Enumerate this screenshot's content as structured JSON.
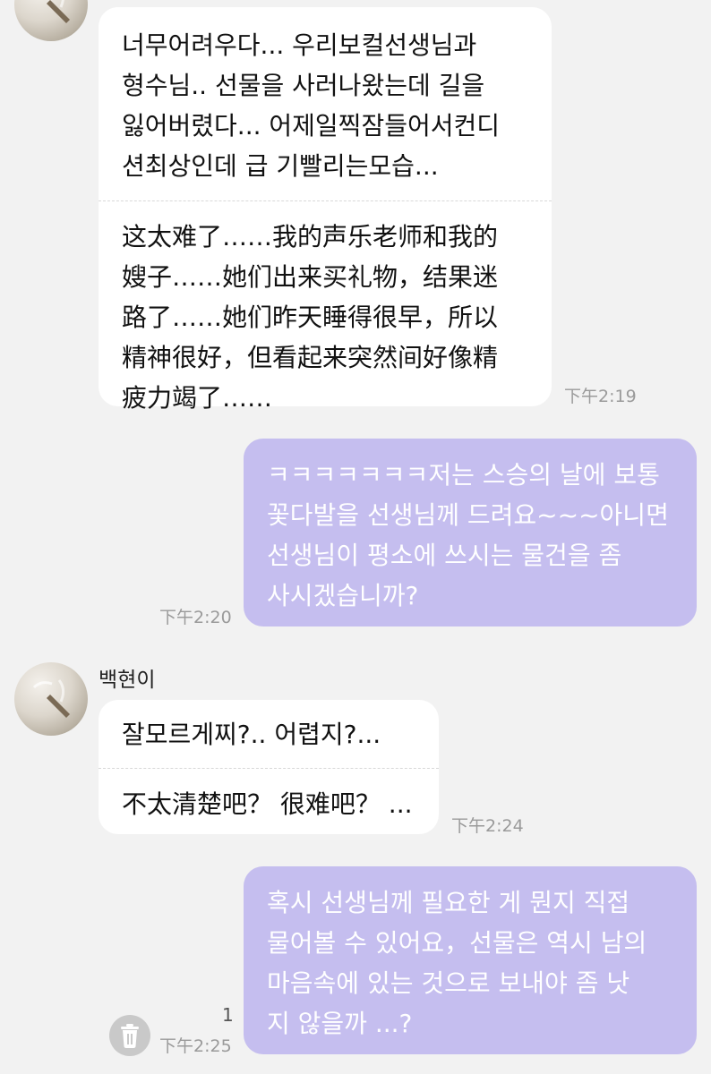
{
  "messages": [
    {
      "direction": "incoming",
      "original": "너무어려우다... 우리보컬선생님과\n형수님.. 선물을 사러나왔는데 길을\n잃어버렸다... 어제일찍잠들어서컨디\n션최상인데 급 기빨리는모습...",
      "translation": "这太难了……我的声乐老师和我的\n嫂子……她们出来买礼物，结果迷\n路了……她们昨天睡得很早，所以\n精神很好，但看起来突然间好像精\n疲力竭了……",
      "time": "下午2:19"
    },
    {
      "direction": "outgoing",
      "text": "ㅋㅋㅋㅋㅋㅋㅋ저는 스승의 날에 보통\n꽃다발을 선생님께 드려요~~~아니면\n선생님이 평소에 쓰시는 물건을 좀\n사시겠습니까?",
      "time": "下午2:20"
    },
    {
      "direction": "incoming",
      "sender": "백현이",
      "original": "잘모르게찌?.. 어렵지?...",
      "translation": "不太清楚吧？ 很难吧？ ...",
      "time": "下午2:24"
    },
    {
      "direction": "outgoing",
      "text": "혹시 선생님께 필요한 게 뭔지 직접\n물어볼 수 있어요，선물은 역시 남의\n마음속에 있는 것으로 보내야 좀 낫\n지 않을까 ...?",
      "time": "下午2:25",
      "unread_count": "1"
    }
  ],
  "icons": {
    "avatar": "profile-photo-icon",
    "delete": "trash-icon"
  },
  "colors": {
    "background": "#f2f2f2",
    "incoming_bubble": "#ffffff",
    "outgoing_bubble": "#c5beef",
    "timestamp": "#9a9a9a"
  }
}
